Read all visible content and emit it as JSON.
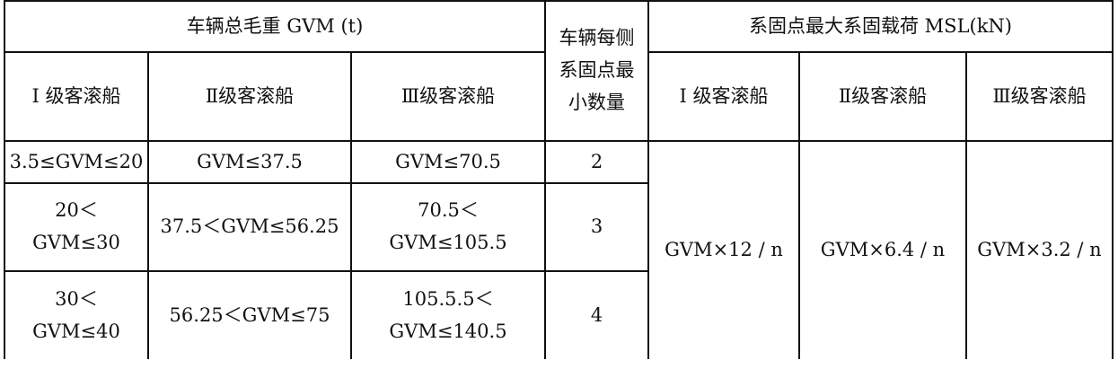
{
  "header": {
    "gvm_group": "车辆总毛重 GVM (t)",
    "min_points": [
      "车辆每侧",
      "系固点最",
      "小数量"
    ],
    "msl_group": "系固点最大系固载荷 MSL(kN)",
    "class1": "Ⅰ 级客滚船",
    "class2": "Ⅱ级客滚船",
    "class3": "Ⅲ级客滚船",
    "msl_class1": "Ⅰ 级客滚船",
    "msl_class2": "Ⅱ级客滚船",
    "msl_class3": "Ⅲ级客滚船"
  },
  "rows": [
    {
      "c1": [
        "3.5≤GVM≤20"
      ],
      "c2": [
        "GVM≤37.5"
      ],
      "c3": [
        "GVM≤70.5"
      ],
      "n": "2"
    },
    {
      "c1": [
        "20＜",
        "GVM≤30"
      ],
      "c2": [
        "37.5＜GVM≤56.25"
      ],
      "c3": [
        "70.5＜",
        "GVM≤105.5"
      ],
      "n": "3"
    },
    {
      "c1": [
        "30＜",
        "GVM≤40"
      ],
      "c2": [
        "56.25＜GVM≤75"
      ],
      "c3": [
        "105.5.5＜",
        "GVM≤140.5"
      ],
      "n": "4"
    }
  ],
  "msl": {
    "class1": "GVM×12 / n",
    "class2": "GVM×6.4 / n",
    "class3": "GVM×3.2 / n"
  }
}
